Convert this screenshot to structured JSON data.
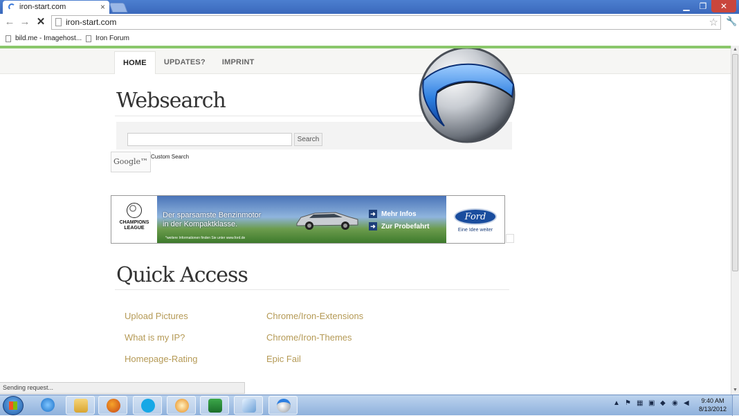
{
  "browser": {
    "tab_title": "iron-start.com",
    "tab_close": "×",
    "url": "iron-start.com",
    "window_buttons": [
      "▁",
      "❐",
      "✕"
    ],
    "bookmarks": [
      "bild.me - Imagehost...",
      "Iron Forum"
    ]
  },
  "site": {
    "menu": [
      "HOME",
      "UPDATES?",
      "IMPRINT"
    ],
    "active_menu": "HOME",
    "websearch_heading": "Websearch",
    "search_button": "Search",
    "google_logo": "Google™",
    "custom_search": "Custom Search",
    "ad": {
      "left_logo_line1": "CHAMPIONS",
      "left_logo_line2": "LEAGUE",
      "headline_line1": "Der sparsamste Benzinmotor",
      "headline_line2": "in der Kompaktklasse.",
      "small_print": "*weitere Informationen finden Sie unter www.ford.de",
      "cta1": "Mehr Infos",
      "cta2": "Zur Probefahrt",
      "brand": "Ford",
      "tagline": "Eine Idee weiter"
    },
    "quick_access_heading": "Quick Access",
    "links_col1": [
      "Upload Pictures",
      "What is my IP?",
      "Homepage-Rating"
    ],
    "links_col2": [
      "Chrome/Iron-Extensions",
      "Chrome/Iron-Themes",
      "Epic Fail"
    ]
  },
  "status_bar": "Sending request...",
  "taskbar": {
    "apps": [
      "internet-explorer",
      "windows-explorer",
      "firefox",
      "skype",
      "app-orange",
      "excel",
      "app-blue",
      "srware-iron"
    ],
    "clock_time": "9:40 AM",
    "clock_date": "8/13/2012"
  }
}
